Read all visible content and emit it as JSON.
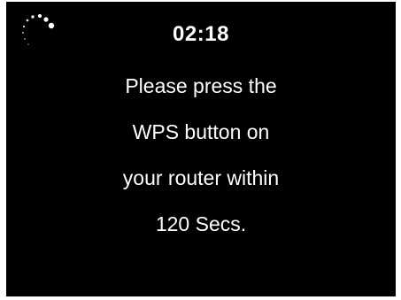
{
  "screen": {
    "spinner_icon": "loading-spinner-icon",
    "timer": "02:18",
    "message_lines": [
      "Please press the",
      "WPS button on",
      "your router within",
      "120 Secs."
    ],
    "colors": {
      "background": "#000000",
      "text": "#ffffff"
    }
  }
}
